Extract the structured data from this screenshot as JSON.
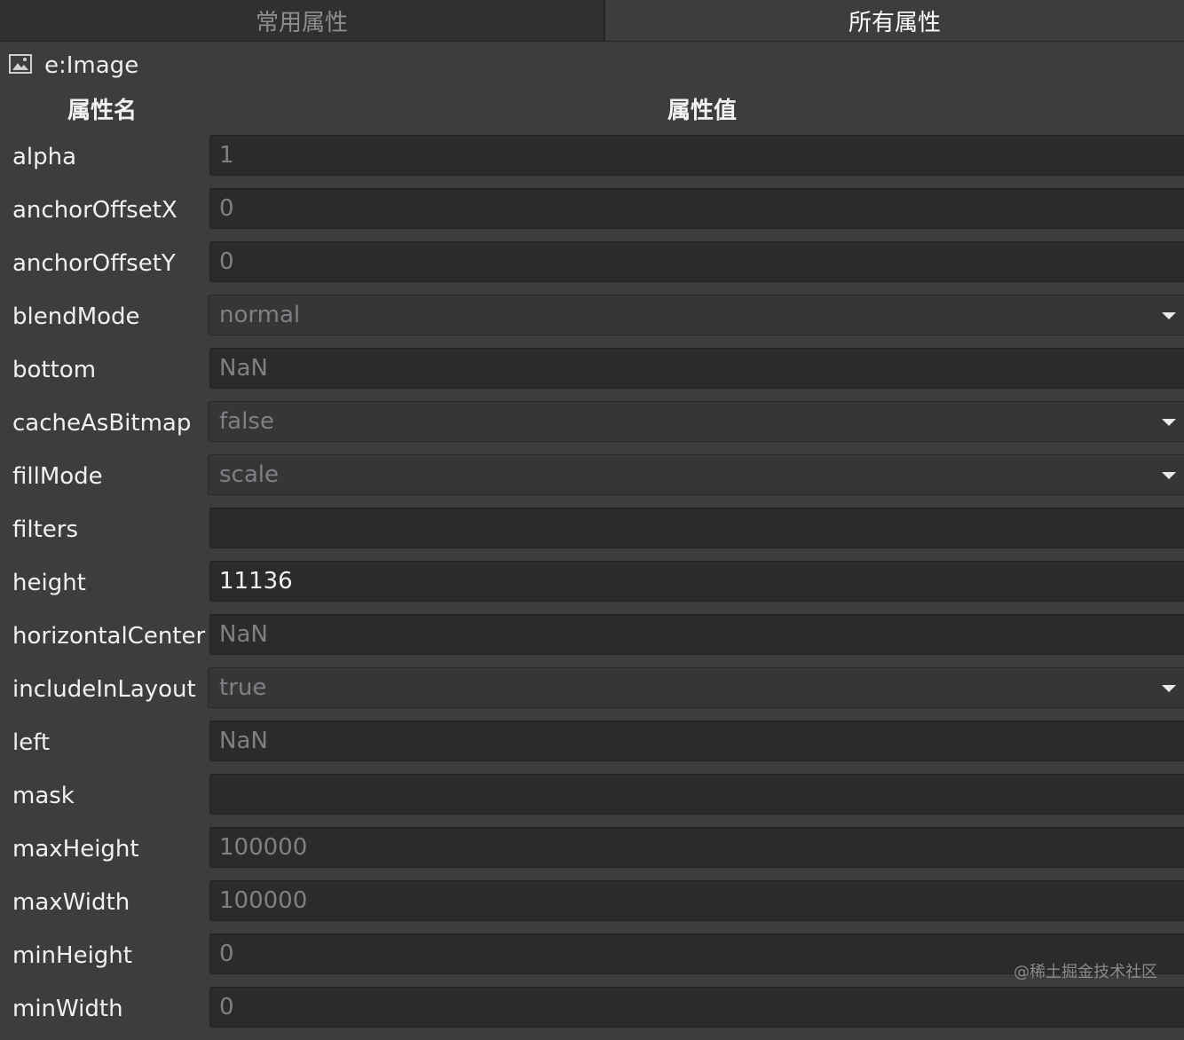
{
  "tabs": [
    {
      "label": "常用属性",
      "active": false
    },
    {
      "label": "所有属性",
      "active": true
    }
  ],
  "node": {
    "icon": "image-icon",
    "name": "e:Image"
  },
  "columns": {
    "name": "属性名",
    "value": "属性值"
  },
  "properties": [
    {
      "name": "alpha",
      "value": "1",
      "type": "text",
      "is_default": true
    },
    {
      "name": "anchorOffsetX",
      "value": "0",
      "type": "text",
      "is_default": true
    },
    {
      "name": "anchorOffsetY",
      "value": "0",
      "type": "text",
      "is_default": true
    },
    {
      "name": "blendMode",
      "value": "normal",
      "type": "select",
      "is_default": true
    },
    {
      "name": "bottom",
      "value": "NaN",
      "type": "text",
      "is_default": true
    },
    {
      "name": "cacheAsBitmap",
      "value": "false",
      "type": "select",
      "is_default": true
    },
    {
      "name": "fillMode",
      "value": "scale",
      "type": "select",
      "is_default": true
    },
    {
      "name": "filters",
      "value": "",
      "type": "text",
      "is_default": true
    },
    {
      "name": "height",
      "value": "11136",
      "type": "text",
      "is_default": false
    },
    {
      "name": "horizontalCenter",
      "value": "NaN",
      "type": "text",
      "is_default": true
    },
    {
      "name": "includeInLayout",
      "value": "true",
      "type": "select",
      "is_default": true
    },
    {
      "name": "left",
      "value": "NaN",
      "type": "text",
      "is_default": true
    },
    {
      "name": "mask",
      "value": "",
      "type": "text",
      "is_default": true
    },
    {
      "name": "maxHeight",
      "value": "100000",
      "type": "text",
      "is_default": true
    },
    {
      "name": "maxWidth",
      "value": "100000",
      "type": "text",
      "is_default": true
    },
    {
      "name": "minHeight",
      "value": "0",
      "type": "text",
      "is_default": true
    },
    {
      "name": "minWidth",
      "value": "0",
      "type": "text",
      "is_default": true
    }
  ],
  "watermark": "@稀土掘金技术社区",
  "colors": {
    "background": "#3c3d3f",
    "field_background": "#2b2b2c",
    "default_value_text": "#7f8083",
    "set_value_text": "#f2f2f2"
  }
}
